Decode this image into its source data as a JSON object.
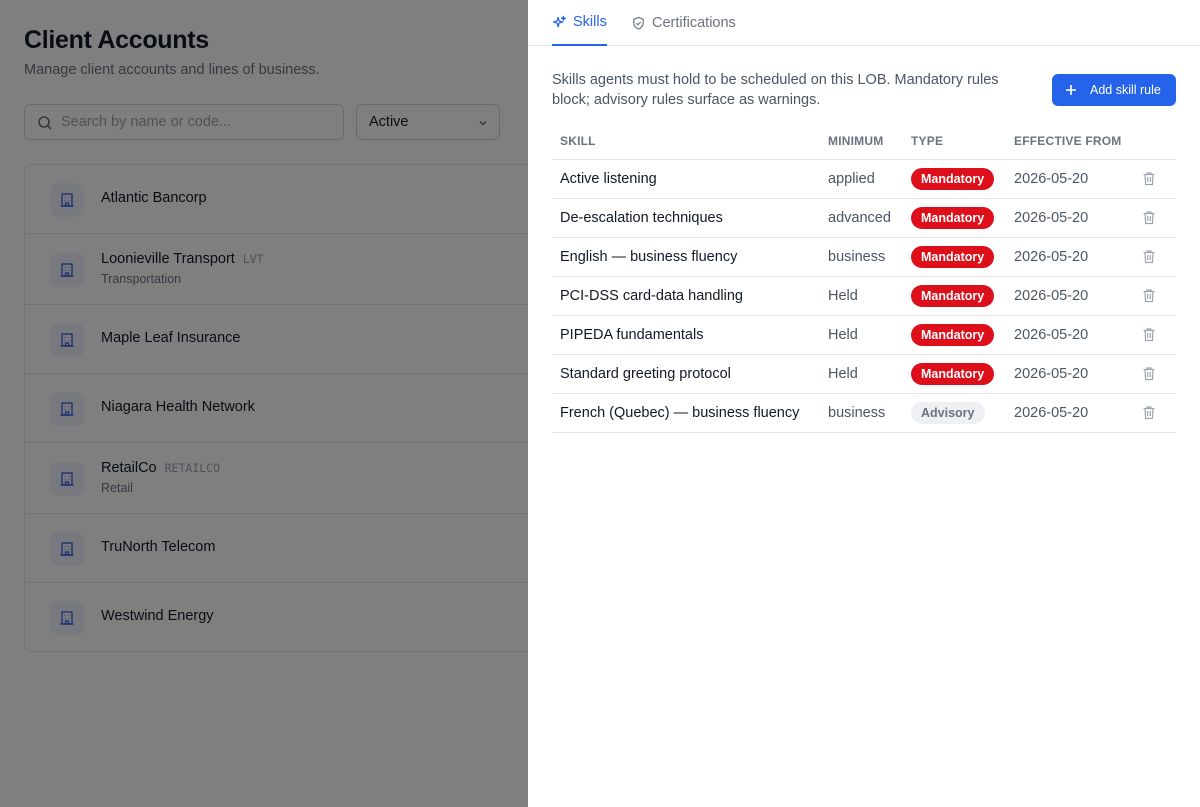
{
  "page": {
    "title": "Client Accounts",
    "subtitle": "Manage client accounts and lines of business.",
    "search": {
      "placeholder": "Search by name or code...",
      "value": ""
    },
    "status_filter": {
      "selected": "Active"
    },
    "accounts": [
      {
        "name": "Atlantic Bancorp",
        "code": "",
        "sub": ""
      },
      {
        "name": "Loonieville Transport",
        "code": "LVT",
        "sub": "Transportation"
      },
      {
        "name": "Maple Leaf Insurance",
        "code": "",
        "sub": ""
      },
      {
        "name": "Niagara Health Network",
        "code": "",
        "sub": ""
      },
      {
        "name": "RetailCo",
        "code": "RETAILCO",
        "sub": "Retail"
      },
      {
        "name": "TruNorth Telecom",
        "code": "",
        "sub": ""
      },
      {
        "name": "Westwind Energy",
        "code": "",
        "sub": ""
      }
    ]
  },
  "drawer": {
    "tabs": [
      {
        "label": "Skills",
        "icon": "sparkles-icon",
        "active": true
      },
      {
        "label": "Certifications",
        "icon": "shield-check-icon",
        "active": false
      }
    ],
    "description": "Skills agents must hold to be scheduled on this LOB. Mandatory rules block; advisory rules surface as warnings.",
    "add_button_label": "Add skill rule",
    "table": {
      "headers": {
        "skill": "Skill",
        "minimum": "Minimum",
        "type": "Type",
        "effective_from": "Effective From"
      },
      "rows": [
        {
          "skill": "Active listening",
          "minimum": "applied",
          "type": "Mandatory",
          "effective_from": "2026-05-20"
        },
        {
          "skill": "De-escalation techniques",
          "minimum": "advanced",
          "type": "Mandatory",
          "effective_from": "2026-05-20"
        },
        {
          "skill": "English — business fluency",
          "minimum": "business",
          "type": "Mandatory",
          "effective_from": "2026-05-20"
        },
        {
          "skill": "PCI-DSS card-data handling",
          "minimum": "Held",
          "type": "Mandatory",
          "effective_from": "2026-05-20"
        },
        {
          "skill": "PIPEDA fundamentals",
          "minimum": "Held",
          "type": "Mandatory",
          "effective_from": "2026-05-20"
        },
        {
          "skill": "Standard greeting protocol",
          "minimum": "Held",
          "type": "Mandatory",
          "effective_from": "2026-05-20"
        },
        {
          "skill": "French (Quebec) — business fluency",
          "minimum": "business",
          "type": "Advisory",
          "effective_from": "2026-05-20"
        }
      ]
    }
  },
  "colors": {
    "accent": "#2563eb",
    "mandatory": "#dc0f1a",
    "advisory_bg": "#eef0f3"
  }
}
